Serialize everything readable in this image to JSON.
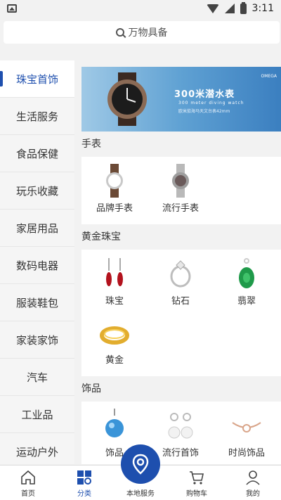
{
  "status_bar": {
    "time": "3:11"
  },
  "search": {
    "placeholder": "万物具备"
  },
  "sidebar": {
    "items": [
      {
        "label": "珠宝首饰",
        "active": true
      },
      {
        "label": "生活服务"
      },
      {
        "label": "食品保健"
      },
      {
        "label": "玩乐收藏"
      },
      {
        "label": "家居用品"
      },
      {
        "label": "数码电器"
      },
      {
        "label": "服装鞋包"
      },
      {
        "label": "家装家饰"
      },
      {
        "label": "汽车"
      },
      {
        "label": "工业品"
      },
      {
        "label": "运动户外"
      }
    ]
  },
  "banner": {
    "title": "300米潜水表",
    "subtitle": "300 meter diving watch",
    "tagline": "欧米茄海马天文台表42mm",
    "brand": "OMEGA"
  },
  "sections": [
    {
      "title": "手表",
      "items": [
        {
          "label": "品牌手表",
          "icon": "watch-icon"
        },
        {
          "label": "流行手表",
          "icon": "watch-icon"
        }
      ]
    },
    {
      "title": "黄金珠宝",
      "items": [
        {
          "label": "珠宝",
          "icon": "earring-icon"
        },
        {
          "label": "钻石",
          "icon": "ring-icon"
        },
        {
          "label": "翡翠",
          "icon": "jade-icon"
        },
        {
          "label": "黄金",
          "icon": "gold-ring-icon"
        }
      ]
    },
    {
      "title": "饰品",
      "items": [
        {
          "label": "饰品",
          "icon": "pendant-icon"
        },
        {
          "label": "流行首饰",
          "icon": "pearl-earring-icon"
        },
        {
          "label": "时尚饰品",
          "icon": "bracelet-icon"
        }
      ]
    }
  ],
  "bottom_nav": {
    "items": [
      {
        "label": "首页",
        "icon": "home-icon"
      },
      {
        "label": "分类",
        "icon": "category-icon",
        "active": true
      },
      {
        "label": "本地服务",
        "icon": "location-icon"
      },
      {
        "label": "购物车",
        "icon": "cart-icon"
      },
      {
        "label": "我的",
        "icon": "user-icon"
      }
    ]
  },
  "colors": {
    "accent": "#1e4fae",
    "background": "#f2f2f2"
  }
}
